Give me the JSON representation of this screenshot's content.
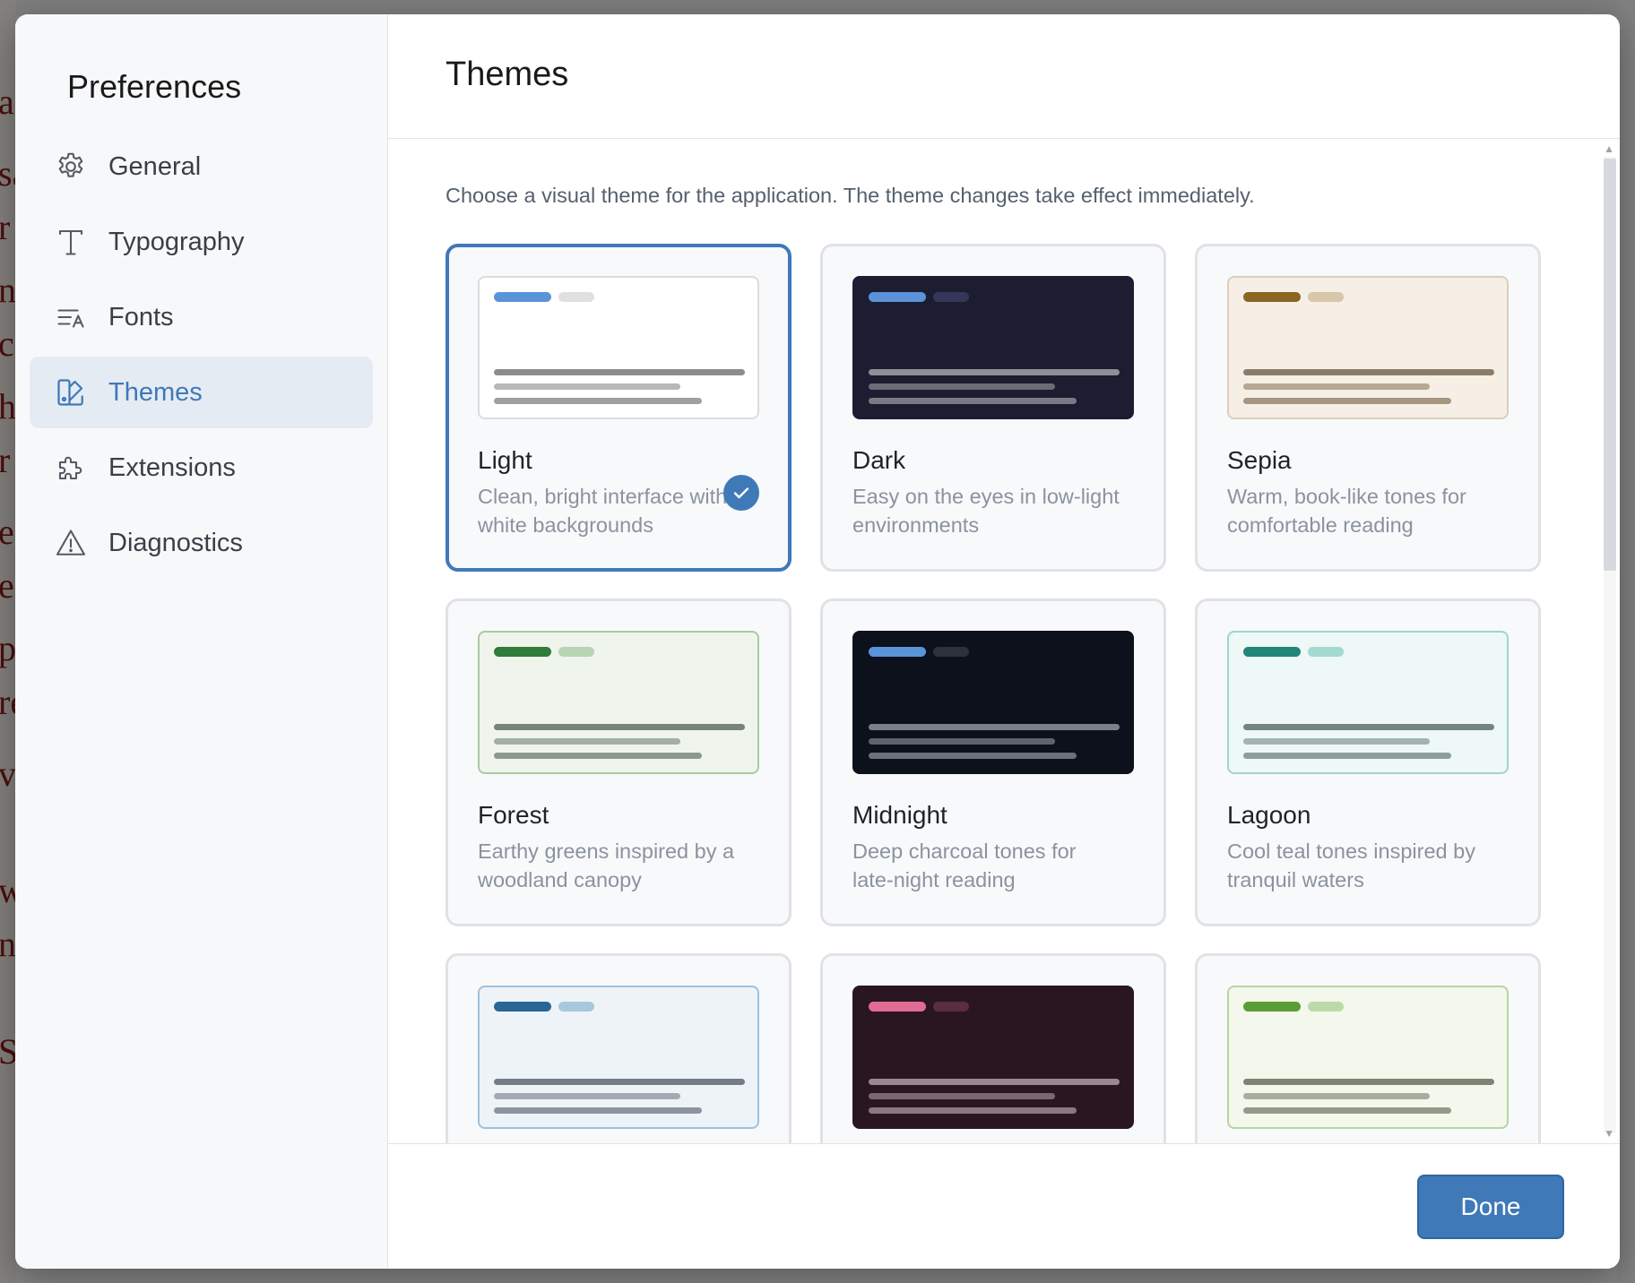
{
  "sidebar": {
    "title": "Preferences",
    "items": [
      {
        "label": "General",
        "icon": "gear-icon"
      },
      {
        "label": "Typography",
        "icon": "typography-icon"
      },
      {
        "label": "Fonts",
        "icon": "fonts-icon"
      },
      {
        "label": "Themes",
        "icon": "themes-icon",
        "active": true
      },
      {
        "label": "Extensions",
        "icon": "puzzle-icon"
      },
      {
        "label": "Diagnostics",
        "icon": "warning-icon"
      }
    ]
  },
  "main": {
    "title": "Themes",
    "description": "Choose a visual theme for the application. The theme changes take effect immediately."
  },
  "themes": [
    {
      "name": "Light",
      "description": "Clean, bright interface with white backgrounds",
      "selected": true,
      "colors": {
        "bg": "#ffffff",
        "border": "#dcdcdc",
        "accent": "#5b93d9",
        "accent2": "#e0e0e0",
        "line1": "#8c8c8c",
        "line2": "#b8b8b8",
        "line3": "#a0a0a0"
      }
    },
    {
      "name": "Dark",
      "description": "Easy on the eyes in low-light environments",
      "selected": false,
      "colors": {
        "bg": "#1c1d31",
        "border": "#1c1d31",
        "accent": "#5b93d9",
        "accent2": "#35365a",
        "line1": "#8e8e98",
        "line2": "#6c6c78",
        "line3": "#7a7a86"
      }
    },
    {
      "name": "Sepia",
      "description": "Warm, book-like tones for comfortable reading",
      "selected": false,
      "colors": {
        "bg": "#f5efe6",
        "border": "#dccfb9",
        "accent": "#8c6520",
        "accent2": "#d8c7a8",
        "line1": "#8c7d6a",
        "line2": "#b6a892",
        "line3": "#a69680"
      }
    },
    {
      "name": "Forest",
      "description": "Earthy greens inspired by a woodland canopy",
      "selected": false,
      "colors": {
        "bg": "#eff4ec",
        "border": "#a9cba4",
        "accent": "#2e7d3a",
        "accent2": "#b8d5b3",
        "line1": "#76827a",
        "line2": "#a2b0a4",
        "line3": "#8c9a8e"
      }
    },
    {
      "name": "Midnight",
      "description": "Deep charcoal tones for late-night reading",
      "selected": false,
      "colors": {
        "bg": "#0d111b",
        "border": "#0d111b",
        "accent": "#5b93d9",
        "accent2": "#2c313c",
        "line1": "#7b8088",
        "line2": "#5e636c",
        "line3": "#6c7079"
      }
    },
    {
      "name": "Lagoon",
      "description": "Cool teal tones inspired by tranquil waters",
      "selected": false,
      "colors": {
        "bg": "#eef8f6",
        "border": "#9ed6cb",
        "accent": "#238577",
        "accent2": "#a4d9cf",
        "line1": "#738581",
        "line2": "#a2b3b0",
        "line3": "#8c9e9a"
      }
    },
    {
      "name": "",
      "description": "",
      "selected": false,
      "colors": {
        "bg": "#eef3f8",
        "border": "#9fc1dc",
        "accent": "#2a6796",
        "accent2": "#a9c8de",
        "line1": "#737d87",
        "line2": "#a2abb4",
        "line3": "#8c959f"
      }
    },
    {
      "name": "",
      "description": "",
      "selected": false,
      "colors": {
        "bg": "#2a1621",
        "border": "#2a1621",
        "accent": "#e06c93",
        "accent2": "#5a2d40",
        "line1": "#9a8890",
        "line2": "#7a6870",
        "line3": "#8a7880"
      }
    },
    {
      "name": "",
      "description": "",
      "selected": false,
      "colors": {
        "bg": "#f3f7ec",
        "border": "#b6d6a2",
        "accent": "#5c9c37",
        "accent2": "#bcdaa7",
        "line1": "#7b8475",
        "line2": "#a6ae9f",
        "line3": "#929a8b"
      }
    }
  ],
  "footer": {
    "done_label": "Done"
  },
  "background": {
    "fragments": [
      "a",
      "sa",
      "r",
      "nt",
      "c",
      "h",
      "r",
      "e",
      "e",
      "p",
      "re",
      "v",
      "w",
      "n",
      "S"
    ]
  }
}
